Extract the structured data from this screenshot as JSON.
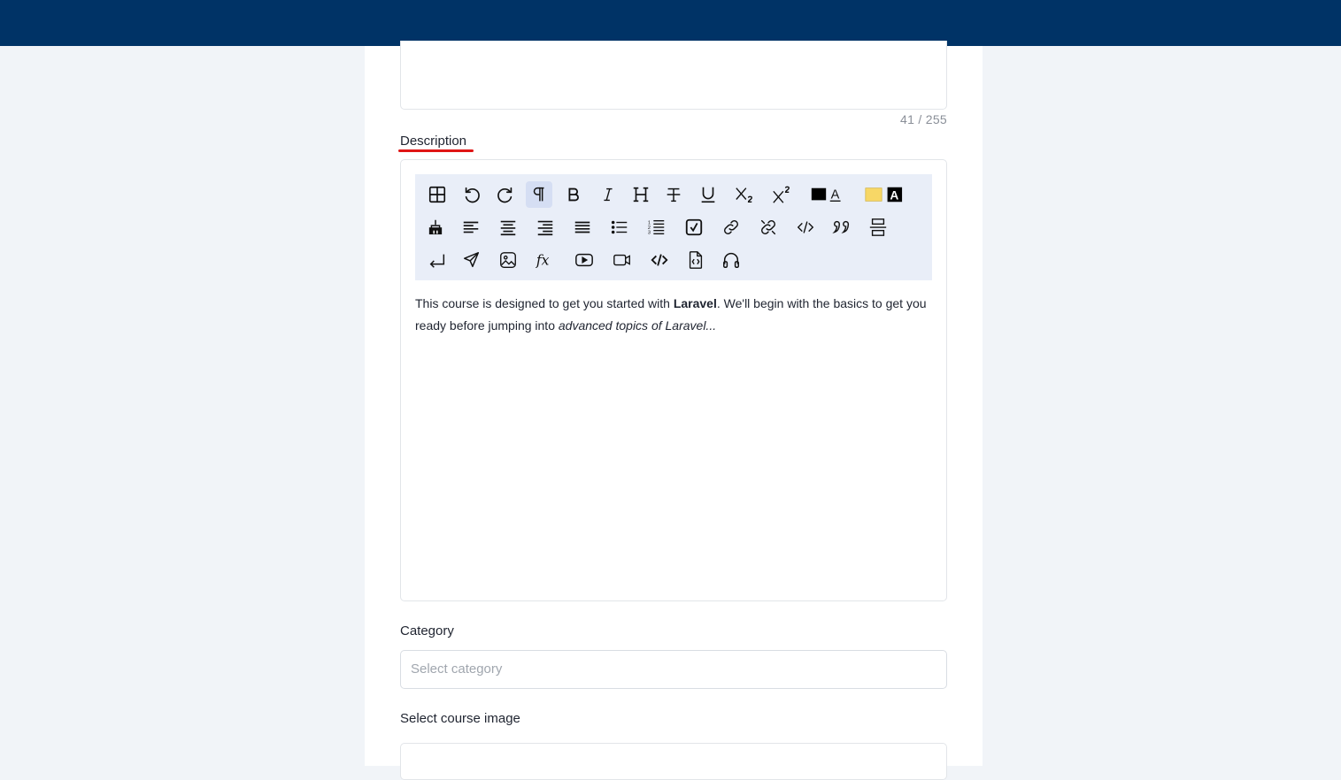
{
  "form": {
    "title_counter": "41 / 255",
    "description_label": "Description",
    "description": {
      "p1": "This course is designed to get you started with ",
      "bold": "Laravel",
      "p2": ". We'll begin with the basics to get you ready before jumping into ",
      "italic": "advanced topics of Laravel..."
    },
    "category_label": "Category",
    "category_placeholder": "Select category",
    "image_label": "Select course image"
  },
  "toolbar": {
    "rows": [
      [
        "table",
        "undo",
        "redo",
        "paragraph",
        "bold",
        "italic",
        "heading",
        "strikethrough",
        "underline",
        "subscript",
        "superscript",
        "font-color",
        "background-color"
      ],
      [
        "clear-format",
        "align-left",
        "align-center",
        "align-right",
        "align-justify",
        "bullet-list",
        "ordered-list",
        "checklist",
        "link",
        "unlink",
        "code",
        "blockquote",
        "horizontal-rule"
      ],
      [
        "hard-break",
        "send",
        "image",
        "formula",
        "youtube",
        "video",
        "code-block",
        "embed",
        "audio"
      ]
    ]
  },
  "colors": {
    "topbar": "#003366",
    "accent_underline": "#e01515",
    "toolbar_bg": "#e9eef8",
    "highlight": "#f7d766"
  }
}
